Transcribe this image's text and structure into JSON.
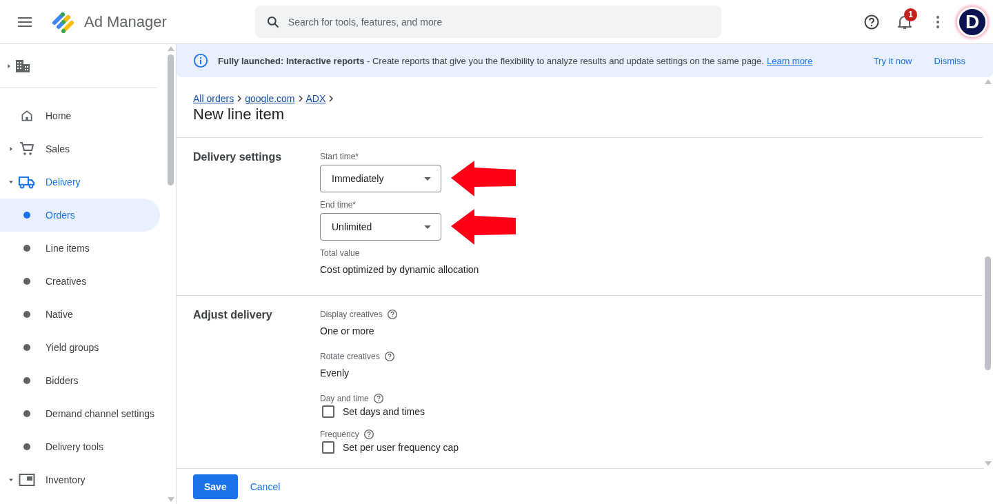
{
  "header": {
    "app_name": "Ad Manager",
    "search": {
      "placeholder": "Search for tools, features, and more"
    },
    "notification_count": "1",
    "avatar_letter": "D"
  },
  "sidebar": {
    "org": {
      "expanded": false
    },
    "items": [
      {
        "label": "Home",
        "kind": "link",
        "selected": false
      },
      {
        "label": "Sales",
        "kind": "group",
        "expanded": false,
        "selected": false
      },
      {
        "label": "Delivery",
        "kind": "group",
        "expanded": true,
        "selected": false,
        "children": [
          {
            "label": "Orders",
            "selected": true
          },
          {
            "label": "Line items",
            "selected": false
          },
          {
            "label": "Creatives",
            "selected": false
          },
          {
            "label": "Native",
            "selected": false
          },
          {
            "label": "Yield groups",
            "selected": false
          },
          {
            "label": "Bidders",
            "selected": false
          },
          {
            "label": "Demand channel settings",
            "selected": false
          },
          {
            "label": "Delivery tools",
            "selected": false
          }
        ]
      },
      {
        "label": "Inventory",
        "kind": "group",
        "expanded": true,
        "selected": false
      }
    ]
  },
  "banner": {
    "text": "**Fully launched: Interactive reports** - Create reports that give you the flexibility to analyze results and update settings on the same page.",
    "link": "Learn more",
    "actions": [
      "Try it now",
      "Dismiss"
    ]
  },
  "breadcrumbs": [
    "All orders",
    "google.com",
    "ADX"
  ],
  "title": "New line item",
  "sections": [
    {
      "title": "Delivery settings",
      "fields": [
        {
          "kind": "dropdown",
          "label": "Start time*",
          "value": "Immediately",
          "annotated": true
        },
        {
          "kind": "dropdown",
          "label": "End time*",
          "value": "Unlimited",
          "annotated": true
        },
        {
          "kind": "text",
          "label": "Total value",
          "value": "Cost optimized by dynamic allocation",
          "help": false
        }
      ]
    },
    {
      "title": "Adjust delivery",
      "fields": [
        {
          "kind": "text",
          "label": "Display creatives",
          "value": "One or more",
          "help": true
        },
        {
          "kind": "text",
          "label": "Rotate creatives",
          "value": "Evenly",
          "help": true
        },
        {
          "kind": "checkbox",
          "label": "Day and time",
          "option": "Set days and times",
          "checked": false,
          "help": true
        },
        {
          "kind": "checkbox",
          "label": "Frequency",
          "option": "Set per user frequency cap",
          "checked": false,
          "help": true
        }
      ]
    }
  ],
  "footer": {
    "save": "Save",
    "cancel": "Cancel"
  }
}
